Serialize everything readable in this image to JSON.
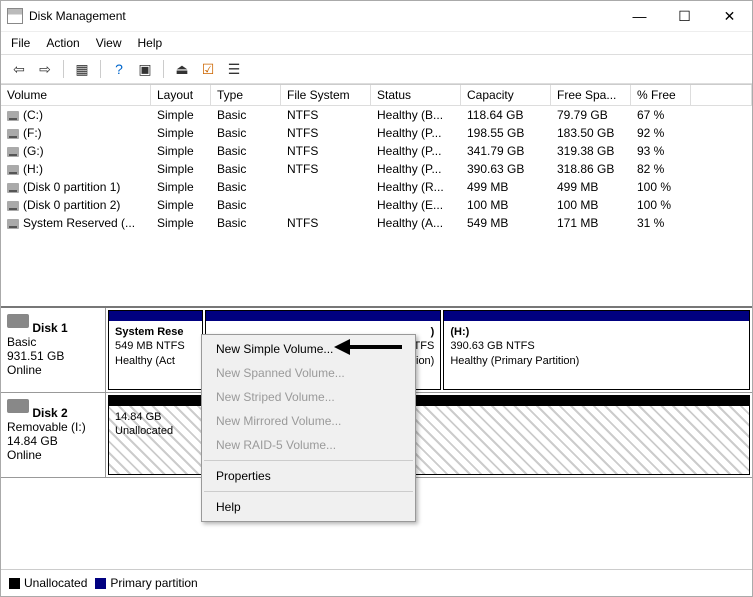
{
  "window": {
    "title": "Disk Management"
  },
  "menus": {
    "file": "File",
    "action": "Action",
    "view": "View",
    "help": "Help"
  },
  "columns": {
    "volume": "Volume",
    "layout": "Layout",
    "type": "Type",
    "fs": "File System",
    "status": "Status",
    "capacity": "Capacity",
    "free": "Free Spa...",
    "pct": "% Free"
  },
  "volumes": [
    {
      "name": "(C:)",
      "layout": "Simple",
      "type": "Basic",
      "fs": "NTFS",
      "status": "Healthy (B...",
      "capacity": "118.64 GB",
      "free": "79.79 GB",
      "pct": "67 %"
    },
    {
      "name": "(F:)",
      "layout": "Simple",
      "type": "Basic",
      "fs": "NTFS",
      "status": "Healthy (P...",
      "capacity": "198.55 GB",
      "free": "183.50 GB",
      "pct": "92 %"
    },
    {
      "name": "(G:)",
      "layout": "Simple",
      "type": "Basic",
      "fs": "NTFS",
      "status": "Healthy (P...",
      "capacity": "341.79 GB",
      "free": "319.38 GB",
      "pct": "93 %"
    },
    {
      "name": "(H:)",
      "layout": "Simple",
      "type": "Basic",
      "fs": "NTFS",
      "status": "Healthy (P...",
      "capacity": "390.63 GB",
      "free": "318.86 GB",
      "pct": "82 %"
    },
    {
      "name": "(Disk 0 partition 1)",
      "layout": "Simple",
      "type": "Basic",
      "fs": "",
      "status": "Healthy (R...",
      "capacity": "499 MB",
      "free": "499 MB",
      "pct": "100 %"
    },
    {
      "name": "(Disk 0 partition 2)",
      "layout": "Simple",
      "type": "Basic",
      "fs": "",
      "status": "Healthy (E...",
      "capacity": "100 MB",
      "free": "100 MB",
      "pct": "100 %"
    },
    {
      "name": "System Reserved (...",
      "layout": "Simple",
      "type": "Basic",
      "fs": "NTFS",
      "status": "Healthy (A...",
      "capacity": "549 MB",
      "free": "171 MB",
      "pct": "31 %"
    }
  ],
  "disk1": {
    "name": "Disk 1",
    "type": "Basic",
    "size": "931.51 GB",
    "state": "Online",
    "p1": {
      "title": "System Rese",
      "line1": "549 MB NTFS",
      "line2": "Healthy (Act"
    },
    "p2": {
      "line1": "79 GB NTFS",
      "line2": "thy (Primary Partition)"
    },
    "p3": {
      "title": "(H:)",
      "line1": "390.63 GB NTFS",
      "line2": "Healthy (Primary Partition)"
    }
  },
  "disk2": {
    "name": "Disk 2",
    "type": "Removable (I:)",
    "size": "14.84 GB",
    "state": "Online",
    "p1": {
      "line1": "14.84 GB",
      "line2": "Unallocated"
    }
  },
  "legend": {
    "unalloc": "Unallocated",
    "primary": "Primary partition"
  },
  "context_menu": {
    "new_simple": "New Simple Volume...",
    "new_spanned": "New Spanned Volume...",
    "new_striped": "New Striped Volume...",
    "new_mirrored": "New Mirrored Volume...",
    "new_raid5": "New RAID-5 Volume...",
    "properties": "Properties",
    "help": "Help"
  }
}
